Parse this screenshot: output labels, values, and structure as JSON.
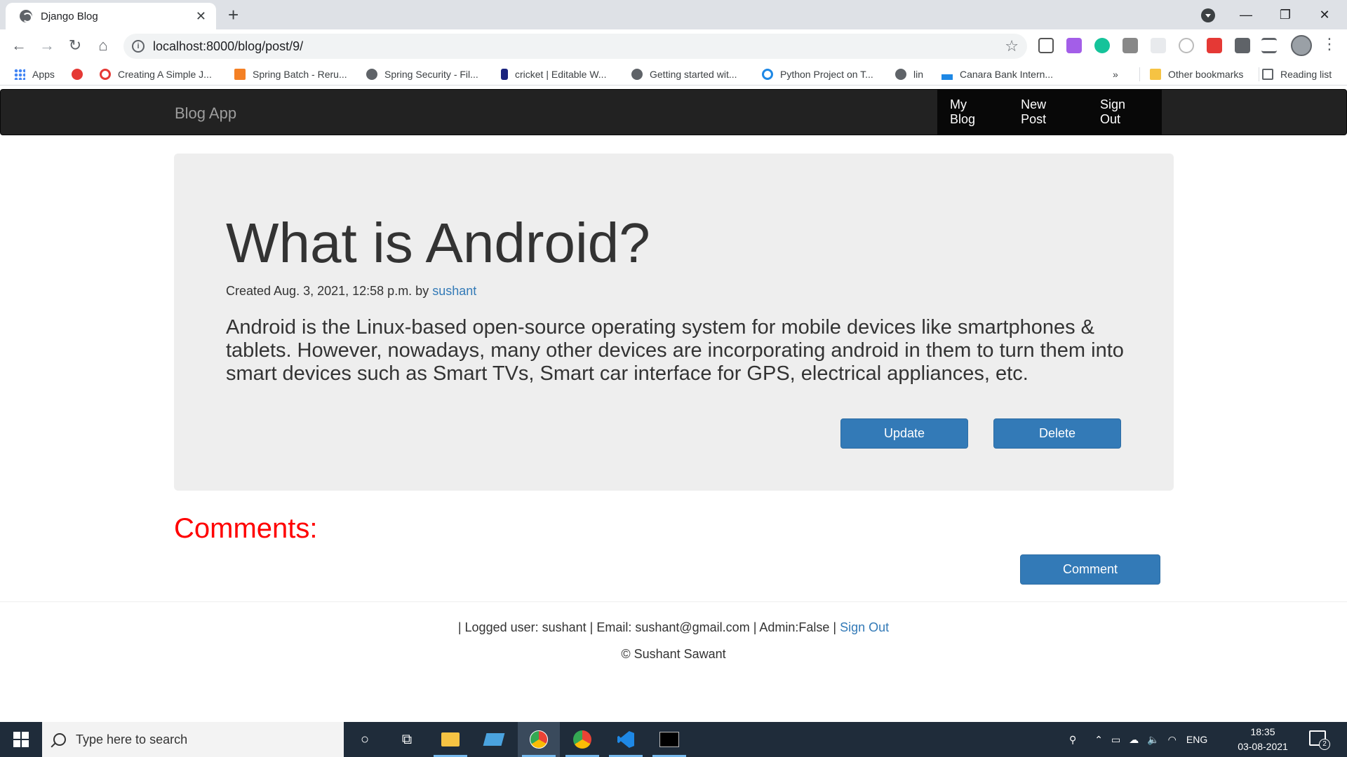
{
  "browser": {
    "tab_title": "Django Blog",
    "tab_close": "✕",
    "new_tab": "+",
    "url": "localhost:8000/blog/post/9/",
    "window_controls": {
      "minimize": "—",
      "restore": "❐",
      "close": "✕"
    },
    "bookmarks": [
      {
        "label": "Apps",
        "icon": "apps-grid-icon"
      },
      {
        "label": "",
        "icon": "youtube-music-icon"
      },
      {
        "label": "Creating A Simple J...",
        "icon": "opera-icon"
      },
      {
        "label": "Spring Batch - Reru...",
        "icon": "stackoverflow-icon"
      },
      {
        "label": "Spring Security - Fil...",
        "icon": "globe-icon"
      },
      {
        "label": "cricket | Editable W...",
        "icon": "cricket-icon"
      },
      {
        "label": "Getting started wit...",
        "icon": "globe-icon"
      },
      {
        "label": "Python Project on T...",
        "icon": "python-icon"
      },
      {
        "label": "lin",
        "icon": "globe-icon"
      },
      {
        "label": "Canara Bank Intern...",
        "icon": "canara-icon"
      }
    ],
    "bookmarks_overflow": "»",
    "other_bookmarks": "Other bookmarks",
    "reading_list": "Reading list"
  },
  "site": {
    "brand": "Blog App",
    "nav": {
      "my_blog": "My Blog",
      "new_post": "New Post",
      "sign_out": "Sign Out"
    }
  },
  "post": {
    "title": "What is Android?",
    "meta_prefix": "Created Aug. 3, 2021, 12:58 p.m. by ",
    "author": "sushant",
    "body": "Android is the Linux-based open-source operating system for mobile devices like smartphones & tablets. However, nowadays, many other devices are incorporating android in them to turn them into smart devices such as Smart TVs, Smart car interface for GPS, electrical appliances, etc.",
    "update_label": "Update",
    "delete_label": "Delete"
  },
  "comments": {
    "heading": "Comments:",
    "comment_label": "Comment"
  },
  "footer": {
    "user_info": "| Logged user: sushant | Email: sushant@gmail.com | Admin:False | ",
    "sign_out": "Sign Out",
    "copyright": "© Sushant Sawant"
  },
  "taskbar": {
    "search_placeholder": "Type here to search",
    "language": "ENG",
    "time": "18:35",
    "date": "03-08-2021",
    "notification_count": "2"
  }
}
